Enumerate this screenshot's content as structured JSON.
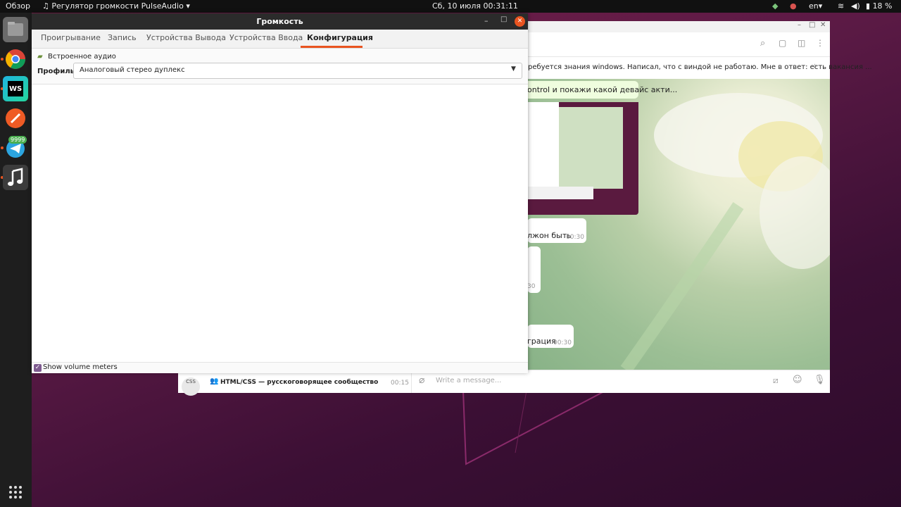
{
  "topbar": {
    "activities": "Обзор",
    "app_menu": "Регулятор громкости PulseAudio",
    "clock": "Сб, 10 июля  00:31:11",
    "language": "en",
    "battery": "18 %"
  },
  "dock": {
    "items": [
      "files",
      "chrome",
      "webstorm",
      "postman",
      "telegram",
      "music"
    ],
    "telegram_badge": "9999"
  },
  "chat": {
    "pinned_text": "ребуется знания windows. Написал, что с виндой не работаю. Мне в ответ: есть вакансия ...",
    "msg1": "ontrol и покажи какой девайс акти...",
    "msg2": "лжон быть",
    "msg2_time": "00:30",
    "msg3_time": "30",
    "msg4": "грация",
    "msg4_time": "00:30",
    "sidebar_chat_name": "HTML/CSS — русскоговорящее сообщество",
    "sidebar_chat_time": "00:15",
    "input_placeholder": "Write a message..."
  },
  "pulse": {
    "title": "Громкость",
    "tabs": [
      "Проигрывание",
      "Запись",
      "Устройства Вывода",
      "Устройства Ввода",
      "Конфигурация"
    ],
    "active_tab": "Конфигурация",
    "card_name": "Встроенное аудио",
    "profile_label": "Профиль:",
    "profile_value": "Аналоговый стерео дуплекс",
    "show_meters_label": "Show volume meters",
    "show_meters_checked": true
  },
  "colors": {
    "accent": "#e95420",
    "checkbox": "#7e5b8f"
  }
}
